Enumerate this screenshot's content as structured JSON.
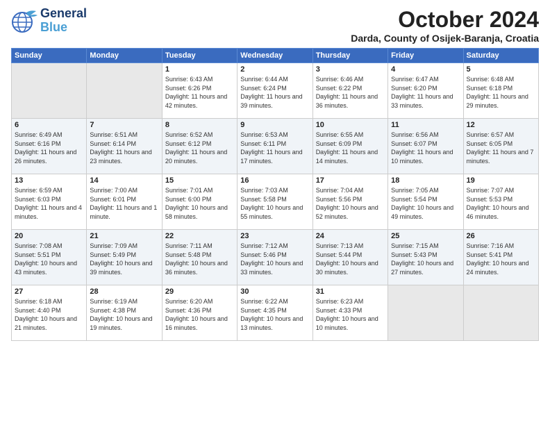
{
  "header": {
    "logo_line1": "General",
    "logo_line2": "Blue",
    "month": "October 2024",
    "location": "Darda, County of Osijek-Baranja, Croatia"
  },
  "weekdays": [
    "Sunday",
    "Monday",
    "Tuesday",
    "Wednesday",
    "Thursday",
    "Friday",
    "Saturday"
  ],
  "weeks": [
    [
      {
        "day": "",
        "empty": true
      },
      {
        "day": "",
        "empty": true
      },
      {
        "day": "1",
        "sunrise": "6:43 AM",
        "sunset": "6:26 PM",
        "daylight": "11 hours and 42 minutes."
      },
      {
        "day": "2",
        "sunrise": "6:44 AM",
        "sunset": "6:24 PM",
        "daylight": "11 hours and 39 minutes."
      },
      {
        "day": "3",
        "sunrise": "6:46 AM",
        "sunset": "6:22 PM",
        "daylight": "11 hours and 36 minutes."
      },
      {
        "day": "4",
        "sunrise": "6:47 AM",
        "sunset": "6:20 PM",
        "daylight": "11 hours and 33 minutes."
      },
      {
        "day": "5",
        "sunrise": "6:48 AM",
        "sunset": "6:18 PM",
        "daylight": "11 hours and 29 minutes."
      }
    ],
    [
      {
        "day": "6",
        "sunrise": "6:49 AM",
        "sunset": "6:16 PM",
        "daylight": "11 hours and 26 minutes."
      },
      {
        "day": "7",
        "sunrise": "6:51 AM",
        "sunset": "6:14 PM",
        "daylight": "11 hours and 23 minutes."
      },
      {
        "day": "8",
        "sunrise": "6:52 AM",
        "sunset": "6:12 PM",
        "daylight": "11 hours and 20 minutes."
      },
      {
        "day": "9",
        "sunrise": "6:53 AM",
        "sunset": "6:11 PM",
        "daylight": "11 hours and 17 minutes."
      },
      {
        "day": "10",
        "sunrise": "6:55 AM",
        "sunset": "6:09 PM",
        "daylight": "11 hours and 14 minutes."
      },
      {
        "day": "11",
        "sunrise": "6:56 AM",
        "sunset": "6:07 PM",
        "daylight": "11 hours and 10 minutes."
      },
      {
        "day": "12",
        "sunrise": "6:57 AM",
        "sunset": "6:05 PM",
        "daylight": "11 hours and 7 minutes."
      }
    ],
    [
      {
        "day": "13",
        "sunrise": "6:59 AM",
        "sunset": "6:03 PM",
        "daylight": "11 hours and 4 minutes."
      },
      {
        "day": "14",
        "sunrise": "7:00 AM",
        "sunset": "6:01 PM",
        "daylight": "11 hours and 1 minute."
      },
      {
        "day": "15",
        "sunrise": "7:01 AM",
        "sunset": "6:00 PM",
        "daylight": "10 hours and 58 minutes."
      },
      {
        "day": "16",
        "sunrise": "7:03 AM",
        "sunset": "5:58 PM",
        "daylight": "10 hours and 55 minutes."
      },
      {
        "day": "17",
        "sunrise": "7:04 AM",
        "sunset": "5:56 PM",
        "daylight": "10 hours and 52 minutes."
      },
      {
        "day": "18",
        "sunrise": "7:05 AM",
        "sunset": "5:54 PM",
        "daylight": "10 hours and 49 minutes."
      },
      {
        "day": "19",
        "sunrise": "7:07 AM",
        "sunset": "5:53 PM",
        "daylight": "10 hours and 46 minutes."
      }
    ],
    [
      {
        "day": "20",
        "sunrise": "7:08 AM",
        "sunset": "5:51 PM",
        "daylight": "10 hours and 43 minutes."
      },
      {
        "day": "21",
        "sunrise": "7:09 AM",
        "sunset": "5:49 PM",
        "daylight": "10 hours and 39 minutes."
      },
      {
        "day": "22",
        "sunrise": "7:11 AM",
        "sunset": "5:48 PM",
        "daylight": "10 hours and 36 minutes."
      },
      {
        "day": "23",
        "sunrise": "7:12 AM",
        "sunset": "5:46 PM",
        "daylight": "10 hours and 33 minutes."
      },
      {
        "day": "24",
        "sunrise": "7:13 AM",
        "sunset": "5:44 PM",
        "daylight": "10 hours and 30 minutes."
      },
      {
        "day": "25",
        "sunrise": "7:15 AM",
        "sunset": "5:43 PM",
        "daylight": "10 hours and 27 minutes."
      },
      {
        "day": "26",
        "sunrise": "7:16 AM",
        "sunset": "5:41 PM",
        "daylight": "10 hours and 24 minutes."
      }
    ],
    [
      {
        "day": "27",
        "sunrise": "6:18 AM",
        "sunset": "4:40 PM",
        "daylight": "10 hours and 21 minutes."
      },
      {
        "day": "28",
        "sunrise": "6:19 AM",
        "sunset": "4:38 PM",
        "daylight": "10 hours and 19 minutes."
      },
      {
        "day": "29",
        "sunrise": "6:20 AM",
        "sunset": "4:36 PM",
        "daylight": "10 hours and 16 minutes."
      },
      {
        "day": "30",
        "sunrise": "6:22 AM",
        "sunset": "4:35 PM",
        "daylight": "10 hours and 13 minutes."
      },
      {
        "day": "31",
        "sunrise": "6:23 AM",
        "sunset": "4:33 PM",
        "daylight": "10 hours and 10 minutes."
      },
      {
        "day": "",
        "empty": true
      },
      {
        "day": "",
        "empty": true
      }
    ]
  ]
}
